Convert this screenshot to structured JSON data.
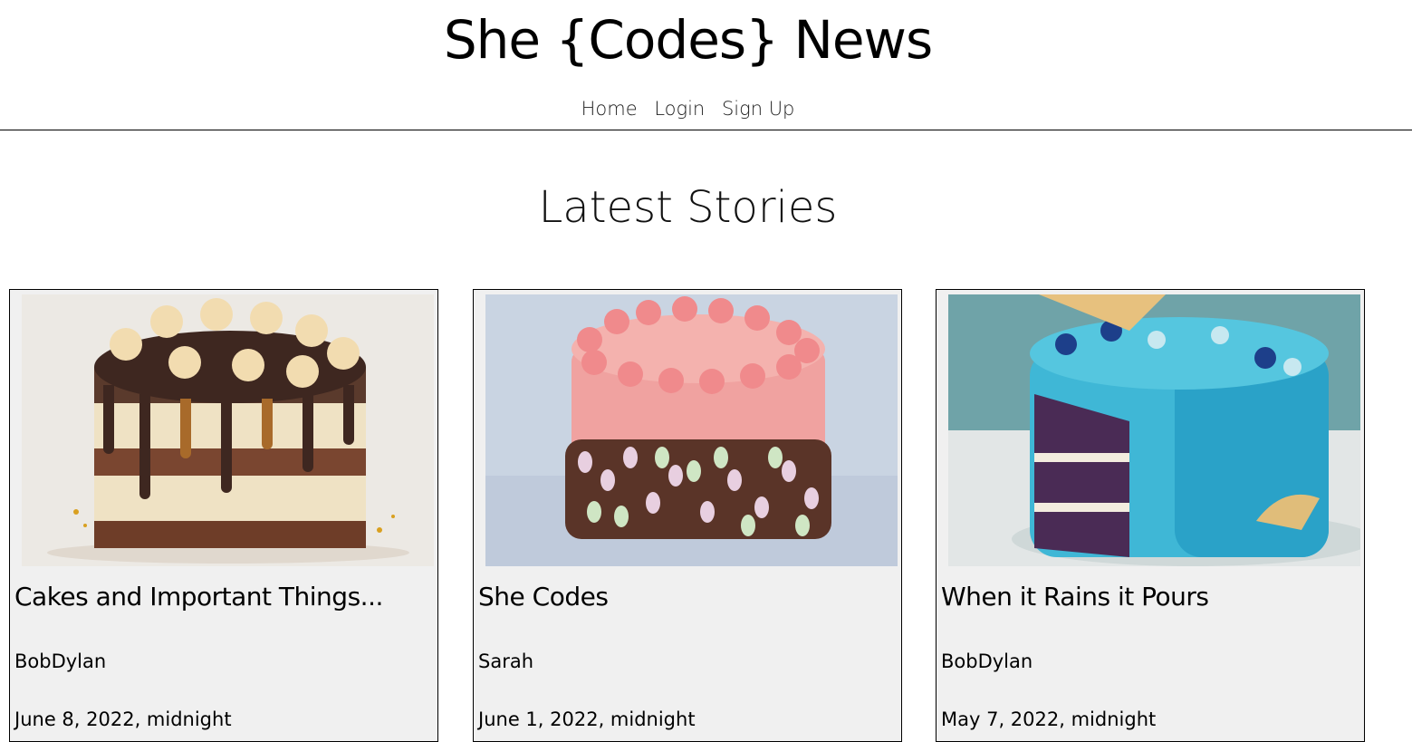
{
  "header": {
    "title": "She {Codes} News",
    "nav": [
      {
        "label": "Home"
      },
      {
        "label": "Login"
      },
      {
        "label": "Sign Up"
      }
    ]
  },
  "main": {
    "section_title": "Latest Stories",
    "stories": [
      {
        "title": "Cakes and Important Things...",
        "author": "BobDylan",
        "date": "June 8, 2022, midnight",
        "image": "chocolate-drip-cake"
      },
      {
        "title": "She Codes",
        "author": "Sarah",
        "date": "June 1, 2022, midnight",
        "image": "pink-buttercream-cake"
      },
      {
        "title": "When it Rains it Pours",
        "author": "BobDylan",
        "date": "May 7, 2022, midnight",
        "image": "mermaid-blue-cake"
      }
    ]
  }
}
